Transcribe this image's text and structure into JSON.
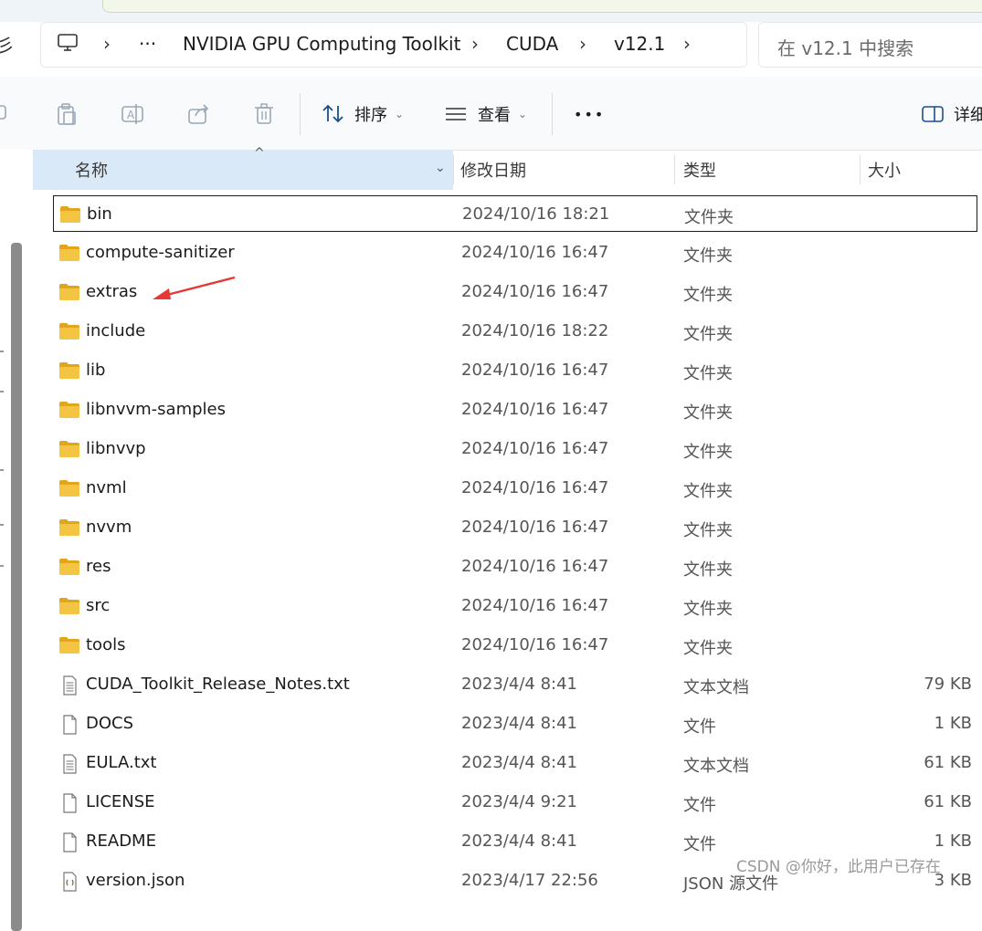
{
  "address_bar": {
    "edge_glyph": "彡",
    "breadcrumbs": [
      "NVIDIA GPU Computing Toolkit",
      "CUDA",
      "v12.1"
    ],
    "overflow": "···"
  },
  "search": {
    "placeholder": "在 v12.1 中搜索"
  },
  "toolbar": {
    "sort_label": "排序",
    "view_label": "查看",
    "more_label": "•••",
    "details_label": "详细"
  },
  "columns": {
    "name": "名称",
    "date": "修改日期",
    "type": "类型",
    "size": "大小"
  },
  "files": [
    {
      "name": "bin",
      "date": "2024/10/16 18:21",
      "type": "文件夹",
      "size": "",
      "icon": "folder-icon"
    },
    {
      "name": "compute-sanitizer",
      "date": "2024/10/16 16:47",
      "type": "文件夹",
      "size": "",
      "icon": "folder-icon"
    },
    {
      "name": "extras",
      "date": "2024/10/16 16:47",
      "type": "文件夹",
      "size": "",
      "icon": "folder-icon"
    },
    {
      "name": "include",
      "date": "2024/10/16 18:22",
      "type": "文件夹",
      "size": "",
      "icon": "folder-icon"
    },
    {
      "name": "lib",
      "date": "2024/10/16 16:47",
      "type": "文件夹",
      "size": "",
      "icon": "folder-icon"
    },
    {
      "name": "libnvvm-samples",
      "date": "2024/10/16 16:47",
      "type": "文件夹",
      "size": "",
      "icon": "folder-icon"
    },
    {
      "name": "libnvvp",
      "date": "2024/10/16 16:47",
      "type": "文件夹",
      "size": "",
      "icon": "folder-icon"
    },
    {
      "name": "nvml",
      "date": "2024/10/16 16:47",
      "type": "文件夹",
      "size": "",
      "icon": "folder-icon"
    },
    {
      "name": "nvvm",
      "date": "2024/10/16 16:47",
      "type": "文件夹",
      "size": "",
      "icon": "folder-icon"
    },
    {
      "name": "res",
      "date": "2024/10/16 16:47",
      "type": "文件夹",
      "size": "",
      "icon": "folder-icon"
    },
    {
      "name": "src",
      "date": "2024/10/16 16:47",
      "type": "文件夹",
      "size": "",
      "icon": "folder-icon"
    },
    {
      "name": "tools",
      "date": "2024/10/16 16:47",
      "type": "文件夹",
      "size": "",
      "icon": "folder-icon"
    },
    {
      "name": "CUDA_Toolkit_Release_Notes.txt",
      "date": "2023/4/4 8:41",
      "type": "文本文档",
      "size": "79 KB",
      "icon": "text-file-icon"
    },
    {
      "name": "DOCS",
      "date": "2023/4/4 8:41",
      "type": "文件",
      "size": "1 KB",
      "icon": "file-icon"
    },
    {
      "name": "EULA.txt",
      "date": "2023/4/4 8:41",
      "type": "文本文档",
      "size": "61 KB",
      "icon": "text-file-icon"
    },
    {
      "name": "LICENSE",
      "date": "2023/4/4 9:21",
      "type": "文件",
      "size": "61 KB",
      "icon": "file-icon"
    },
    {
      "name": "README",
      "date": "2023/4/4 8:41",
      "type": "文件",
      "size": "1 KB",
      "icon": "file-icon"
    },
    {
      "name": "version.json",
      "date": "2023/4/17 22:56",
      "type": "JSON 源文件",
      "size": "3 KB",
      "icon": "json-file-icon"
    }
  ],
  "focused_row": 0,
  "annotation": {
    "arrow_target": "extras",
    "arrow_color": "#e53935"
  },
  "watermark": "CSDN @你好，此用户已存在",
  "colors": {
    "folder": "#f4c542",
    "folder_dark": "#e3a51c",
    "sorted_header": "#d9e9f7",
    "accent": "#0067c0"
  }
}
